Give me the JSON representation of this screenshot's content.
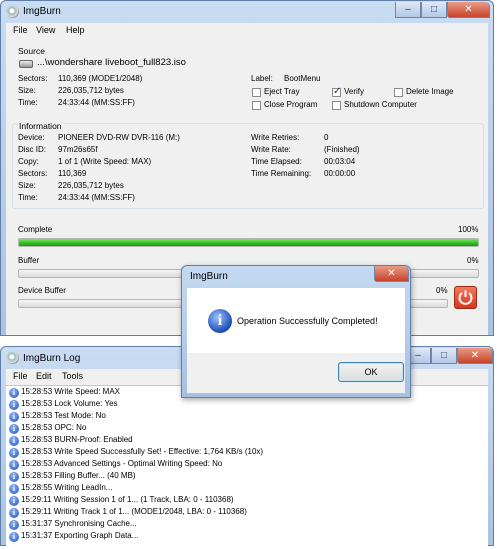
{
  "main_window": {
    "title": "ImgBurn",
    "controls": {
      "minimize": "–",
      "maximize": "□",
      "close": "✕"
    },
    "menu": [
      "File",
      "View",
      "Help"
    ],
    "source": {
      "heading": "Source",
      "file": "...\\wondershare liveboot_full823.iso",
      "sectors_label": "Sectors:",
      "sectors": "110,369 (MODE1/2048)",
      "size_label": "Size:",
      "size": "226,035,712 bytes",
      "time_label": "Time:",
      "time": "24:33:44 (MM:SS:FF)",
      "vol_label_label": "Label:",
      "vol_label": "BootMenu",
      "eject_tray": "Eject Tray",
      "verify": "Verify",
      "delete_image": "Delete Image",
      "close_program": "Close Program",
      "shutdown_computer": "Shutdown Computer",
      "verify_checked": true
    },
    "information": {
      "heading": "Information",
      "device_label": "Device:",
      "device": "PIONEER DVD-RW DVR-116 (M:)",
      "disc_id_label": "Disc ID:",
      "disc_id": "97m26s65f",
      "copy_label": "Copy:",
      "copy": "1 of 1 (Write Speed: MAX)",
      "sectors_label": "Sectors:",
      "sectors": "110,369",
      "size_label": "Size:",
      "size": "226,035,712 bytes",
      "time_label": "Time:",
      "time": "24:33:44 (MM:SS:FF)",
      "write_retries_label": "Write Retries:",
      "write_retries": "0",
      "write_rate_label": "Write Rate:",
      "write_rate": "(Finished)",
      "time_elapsed_label": "Time Elapsed:",
      "time_elapsed": "00:03:04",
      "time_remaining_label": "Time Remaining:",
      "time_remaining": "00:00:00"
    },
    "progress": {
      "complete_label": "Complete",
      "complete_pct": "100%",
      "complete_value": 1.0,
      "buffer_label": "Buffer",
      "buffer_pct": "0%",
      "buffer_value": 0,
      "device_buffer_label": "Device Buffer",
      "device_buffer_pct": "0%",
      "device_buffer_value": 0
    },
    "accent_color": "#2fbf1d",
    "power_button_color": "#d9371c"
  },
  "dialog": {
    "title": "ImgBurn",
    "close": "✕",
    "message": "Operation Successfully Completed!",
    "ok": "OK",
    "icon": "info-icon"
  },
  "log_window": {
    "title": "ImgBurn Log",
    "controls": {
      "minimize": "–",
      "maximize": "□",
      "close": "✕"
    },
    "menu": [
      "File",
      "Edit",
      "Tools"
    ],
    "lines": [
      "15:28:53 Write Speed: MAX",
      "15:28:53 Lock Volume: Yes",
      "15:28:53 Test Mode: No",
      "15:28:53 OPC: No",
      "15:28:53 BURN-Proof: Enabled",
      "15:28:53 Write Speed Successfully Set! - Effective: 1,764 KB/s (10x)",
      "15:28:53 Advanced Settings - Optimal Writing Speed: No",
      "15:28:53 Filling Buffer... (40 MB)",
      "15:28:55 Writing LeadIn...",
      "15:29:11 Writing Session 1 of 1... (1 Track, LBA: 0 - 110368)",
      "15:29:11 Writing Track 1 of 1... (MODE1/2048, LBA: 0 - 110368)",
      "15:31:37 Synchronising Cache...",
      "15:31:37 Exporting Graph Data..."
    ]
  }
}
